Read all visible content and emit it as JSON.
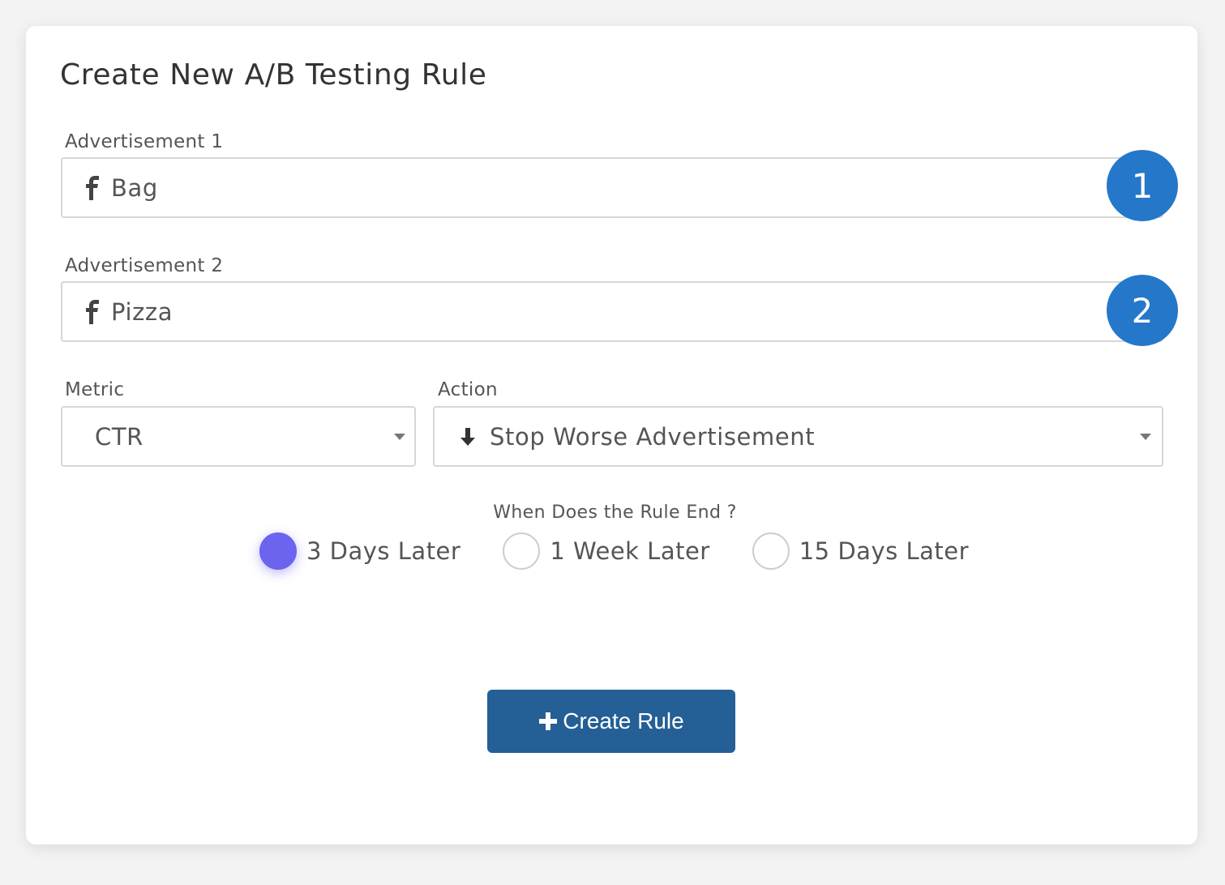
{
  "form": {
    "title": "Create New A/B Testing Rule",
    "ad1": {
      "label": "Advertisement 1",
      "value": "Bag",
      "icon": "facebook-icon",
      "badge": "1"
    },
    "ad2": {
      "label": "Advertisement 2",
      "value": "Pizza",
      "icon": "facebook-icon",
      "badge": "2"
    },
    "metric": {
      "label": "Metric",
      "value": "CTR"
    },
    "action": {
      "label": "Action",
      "value": "Stop Worse Advertisement",
      "icon": "arrow-down-icon"
    },
    "end": {
      "question": "When Does the Rule End ?",
      "options": [
        {
          "label": "3 Days Later",
          "checked": true
        },
        {
          "label": "1 Week Later",
          "checked": false
        },
        {
          "label": "15 Days Later",
          "checked": false
        }
      ]
    },
    "submit_label": "Create Rule"
  },
  "colors": {
    "badge": "#2577c9",
    "radio_checked": "#6c63ef",
    "button": "#245f96"
  }
}
